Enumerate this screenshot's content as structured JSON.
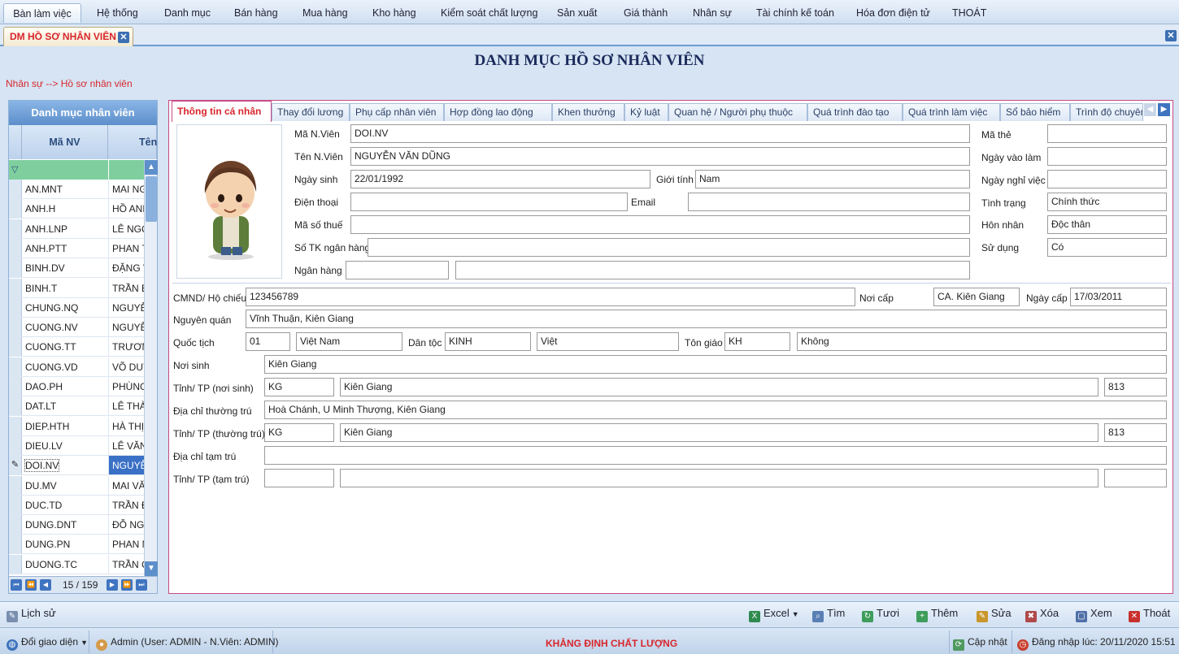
{
  "menu": [
    "Bàn làm việc",
    "Hệ thống",
    "Danh mục",
    "Bán hàng",
    "Mua hàng",
    "Kho hàng",
    "Kiểm soát chất lượng",
    "Sản xuất",
    "Giá thành",
    "Nhân sự",
    "Tài chính kế toán",
    "Hóa đơn điện tử",
    "THOÁT"
  ],
  "doc_tab": "DM HỒ SƠ NHÂN VIÊN",
  "page_title": "DANH MỤC HỒ SƠ NHÂN VIÊN",
  "breadcrumb": "Nhân sự --> Hồ sơ nhân viên",
  "list_panel": {
    "title": "Danh mục nhân viên",
    "col_code": "Mã NV",
    "col_name": "Tên",
    "rows": [
      {
        "code": "AN.MNT",
        "name": "MAI NG"
      },
      {
        "code": "ANH.H",
        "name": "HỒ ANH"
      },
      {
        "code": "ANH.LNP",
        "name": "LÊ NGỌ"
      },
      {
        "code": "ANH.PTT",
        "name": "PHAN T"
      },
      {
        "code": "BINH.DV",
        "name": "ĐẶNG V"
      },
      {
        "code": "BINH.T",
        "name": "TRẦN B"
      },
      {
        "code": "CHUNG.NQ",
        "name": "NGUYỄN"
      },
      {
        "code": "CUONG.NV",
        "name": "NGUYỄN"
      },
      {
        "code": "CUONG.TT",
        "name": "TRƯƠN"
      },
      {
        "code": "CUONG.VD",
        "name": "VÕ DUY"
      },
      {
        "code": "DAO.PH",
        "name": "PHÙNG"
      },
      {
        "code": "DAT.LT",
        "name": "LÊ THÀI"
      },
      {
        "code": "DIEP.HTH",
        "name": "HÀ THỊ"
      },
      {
        "code": "DIEU.LV",
        "name": "LÊ VĂN"
      },
      {
        "code": "DOI.NV",
        "name": "NGUYỄN"
      },
      {
        "code": "DU.MV",
        "name": "MAI VĂ"
      },
      {
        "code": "DUC.TD",
        "name": "TRẦN Đ"
      },
      {
        "code": "DUNG.DNT",
        "name": "ĐỖ NGC"
      },
      {
        "code": "DUNG.PN",
        "name": "PHAN N"
      },
      {
        "code": "DUONG.TC",
        "name": "TRẦN C"
      }
    ],
    "selected_index": 14,
    "pager": "15 / 159"
  },
  "tabs": [
    "Thông tin cá nhân",
    "Thay đổi lương",
    "Phụ cấp nhân viên",
    "Hợp đồng lao động",
    "Khen thưởng",
    "Kỷ luật",
    "Quan hệ / Người phụ thuộc",
    "Quá trình đào tạo",
    "Quá trình làm việc",
    "Sổ bảo hiểm",
    "Trình độ chuyên"
  ],
  "labels": {
    "ma_nv": "Mã N.Viên",
    "ten_nv": "Tên N.Viên",
    "ngay_sinh": "Ngày sinh",
    "gioi_tinh": "Giới tính",
    "dien_thoai": "Điện thoại",
    "email": "Email",
    "ma_so_thue": "Mã số thuế",
    "so_tk": "Số TK ngân hàng",
    "ngan_hang": "Ngân hàng",
    "ma_the": "Mã thẻ",
    "ngay_vao_lam": "Ngày vào làm",
    "ngay_nghi": "Ngày nghỉ việc",
    "tinh_trang": "Tình trạng",
    "hon_nhan": "Hôn nhân",
    "su_dung": "Sử dụng",
    "cmnd": "CMND/ Hộ chiếu",
    "noi_cap": "Nơi cấp",
    "ngay_cap": "Ngày cấp",
    "nguyen_quan": "Nguyên quán",
    "quoc_tich": "Quốc tịch",
    "dan_toc": "Dân tộc",
    "ton_giao": "Tôn giáo",
    "noi_sinh": "Nơi sinh",
    "tinh_noi_sinh": "Tỉnh/ TP (nơi sinh)",
    "dc_thuong_tru": "Địa chỉ thường trú",
    "tinh_thuong_tru": "Tỉnh/ TP (thường trú)",
    "dc_tam_tru": "Địa chỉ tạm trú",
    "tinh_tam_tru": "Tỉnh/ TP (tạm trú)"
  },
  "values": {
    "ma_nv": "DOI.NV",
    "ten_nv": "NGUYỄN VĂN DŨNG",
    "ngay_sinh": "22/01/1992",
    "gioi_tinh": "Nam",
    "dien_thoai": "",
    "email": "",
    "ma_so_thue": "",
    "so_tk": "",
    "ngan_hang_code": "",
    "ngan_hang_name": "",
    "ma_the": "",
    "ngay_vao_lam": "",
    "ngay_nghi": "",
    "tinh_trang": "Chính thức",
    "hon_nhan": "Độc thân",
    "su_dung": "Có",
    "cmnd": "123456789",
    "noi_cap": "CA. Kiên Giang",
    "ngay_cap": "17/03/2011",
    "nguyen_quan": "Vĩnh Thuận, Kiên Giang",
    "quoc_tich_code": "01",
    "quoc_tich_name": "Việt Nam",
    "dan_toc_code": "KINH",
    "dan_toc_name": "Việt",
    "ton_giao_code": "KH",
    "ton_giao_name": "Không",
    "noi_sinh": "Kiên Giang",
    "tinh_ns_code": "KG",
    "tinh_ns_name": "Kiên Giang",
    "tinh_ns_num": "813",
    "dc_thuong_tru": "Hoà Chánh, U Minh Thượng, Kiên Giang",
    "tinh_tt_code": "KG",
    "tinh_tt_name": "Kiên Giang",
    "tinh_tt_num": "813",
    "dc_tam_tru": "",
    "tinh_tamtru_code": "",
    "tinh_tamtru_name": "",
    "tinh_tamtru_num": ""
  },
  "bottom": {
    "history": "Lịch sử",
    "excel": "Excel",
    "search": "Tìm",
    "refresh": "Tươi",
    "add": "Thêm",
    "edit": "Sửa",
    "delete": "Xóa",
    "view": "Xem",
    "exit": "Thoát"
  },
  "status": {
    "interface": "Đổi giao diện",
    "user": "Admin (User: ADMIN - N.Viên: ADMIN)",
    "slogan": "KHẲNG ĐỊNH CHẤT LƯỢNG",
    "update": "Cập nhật",
    "login": "Đăng nhập lúc: 20/11/2020 15:51"
  }
}
